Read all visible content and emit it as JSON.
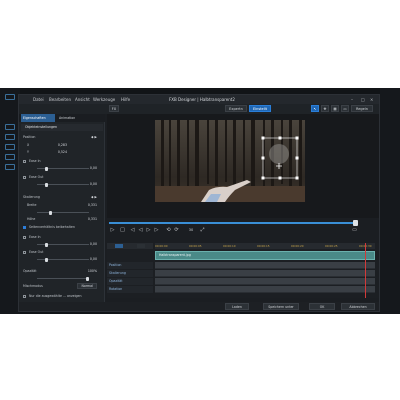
{
  "window": {
    "title": "FXB Designer | Halbtransparent2",
    "menu": [
      "Datei",
      "Bearbeiten",
      "Ansicht",
      "Werkzeuge",
      "Hilfe"
    ]
  },
  "toolbar": {
    "left_label": "FX",
    "mode_a": "Expertn",
    "mode_b": "Einstellt",
    "right_label": "Regeln"
  },
  "panel": {
    "tabs": [
      "Eigenschaften",
      "Animation"
    ],
    "section_object": "Objekteinstellungen",
    "position_label": "Position",
    "x_label": "X",
    "x_value": "0,283",
    "y_label": "Y",
    "y_value": "0,524",
    "ease_in_label": "Ease In",
    "ease_in_value": "0,00",
    "ease_out_label": "Ease Out",
    "ease_out_value": "0,00",
    "scale_label": "Skalierung",
    "scale_value": "0,331",
    "width_label": "Breite",
    "height_label": "Höhe",
    "height_value": "0,331",
    "aspect_label": "Seitenverhältnis beibehalten",
    "ease_in2_label": "Ease In",
    "ease_in2_value": "0,00",
    "ease_out2_label": "Ease Out",
    "ease_out2_value": "0,00",
    "opacity_label": "Opazität",
    "opacity_value": "100%",
    "blend_label": "Mischmodus",
    "blend_value": "Normal",
    "footer_check": "Nur die ausgewählte ... anzeigen"
  },
  "controls": {
    "zoom": "30",
    "symbols": [
      "▷",
      "□",
      "◁",
      "◁",
      "▷",
      "▷",
      "⟲",
      "⟳",
      "⤢"
    ]
  },
  "timeline": {
    "ruler": [
      "00:00:00",
      "00:00:05",
      "00:00:10",
      "00:00:15",
      "00:00:20",
      "00:00:25",
      "00:00:30"
    ],
    "clip_name": "Halbtransparent.jpg",
    "tracks": [
      "Position",
      "Skalierung",
      "Opazität",
      "Rotation"
    ]
  },
  "footer": {
    "buttons": [
      "Laden",
      "Speichern unter",
      "OK",
      "Abbrechen"
    ]
  },
  "colors": {
    "accent": "#1f67b5",
    "clip": "#4a8a88",
    "playhead": "#d23a3a"
  }
}
